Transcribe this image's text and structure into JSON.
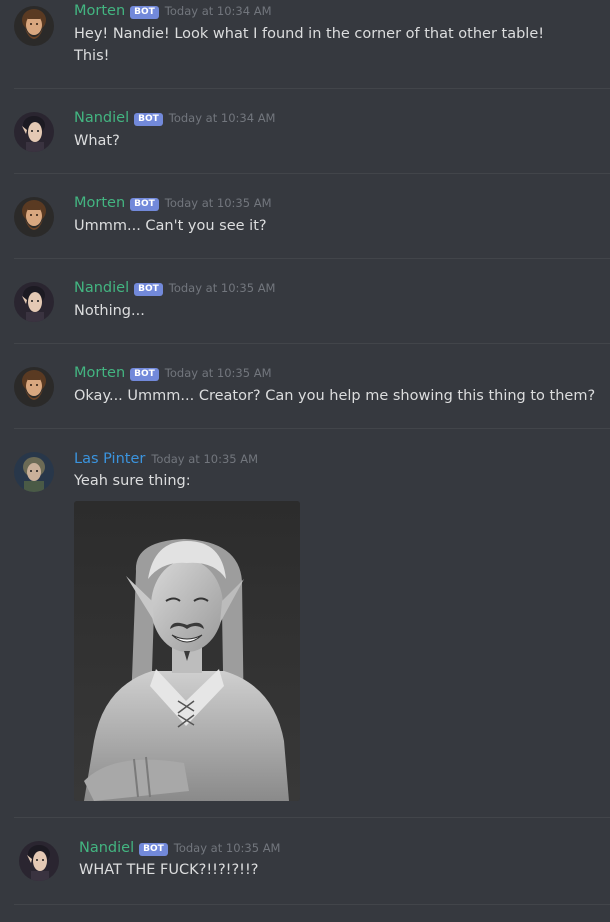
{
  "badge": {
    "bot_label": "BOT"
  },
  "messages": [
    {
      "author": "Morten",
      "is_bot": true,
      "timestamp": "Today at 10:34 AM",
      "lines": [
        "Hey! Nandie! Look what I found in the corner of that other table!",
        "This!"
      ]
    },
    {
      "author": "Nandiel",
      "is_bot": true,
      "timestamp": "Today at 10:34 AM",
      "lines": [
        "What?"
      ]
    },
    {
      "author": "Morten",
      "is_bot": true,
      "timestamp": "Today at 10:35 AM",
      "lines": [
        "Ummm... Can't you see it?"
      ]
    },
    {
      "author": "Nandiel",
      "is_bot": true,
      "timestamp": "Today at 10:35 AM",
      "lines": [
        "Nothing..."
      ]
    },
    {
      "author": "Morten",
      "is_bot": true,
      "timestamp": "Today at 10:35 AM",
      "lines": [
        "Okay... Ummm... Creator? Can you help me showing this thing to them?"
      ]
    },
    {
      "author": "Las Pinter",
      "is_bot": false,
      "timestamp": "Today at 10:35 AM",
      "lines": [
        "Yeah sure thing:"
      ]
    },
    {
      "author": "Nandiel",
      "is_bot": true,
      "timestamp": "Today at 10:35 AM",
      "lines": [
        "WHAT THE FUCK?!!?!?!!?"
      ]
    }
  ],
  "colors": {
    "background": "#36393f",
    "bot_username": "#43b581",
    "user_username": "#3b94de",
    "bot_tag": "#7289da",
    "timestamp": "#72767d",
    "message_text": "#dcddde"
  }
}
